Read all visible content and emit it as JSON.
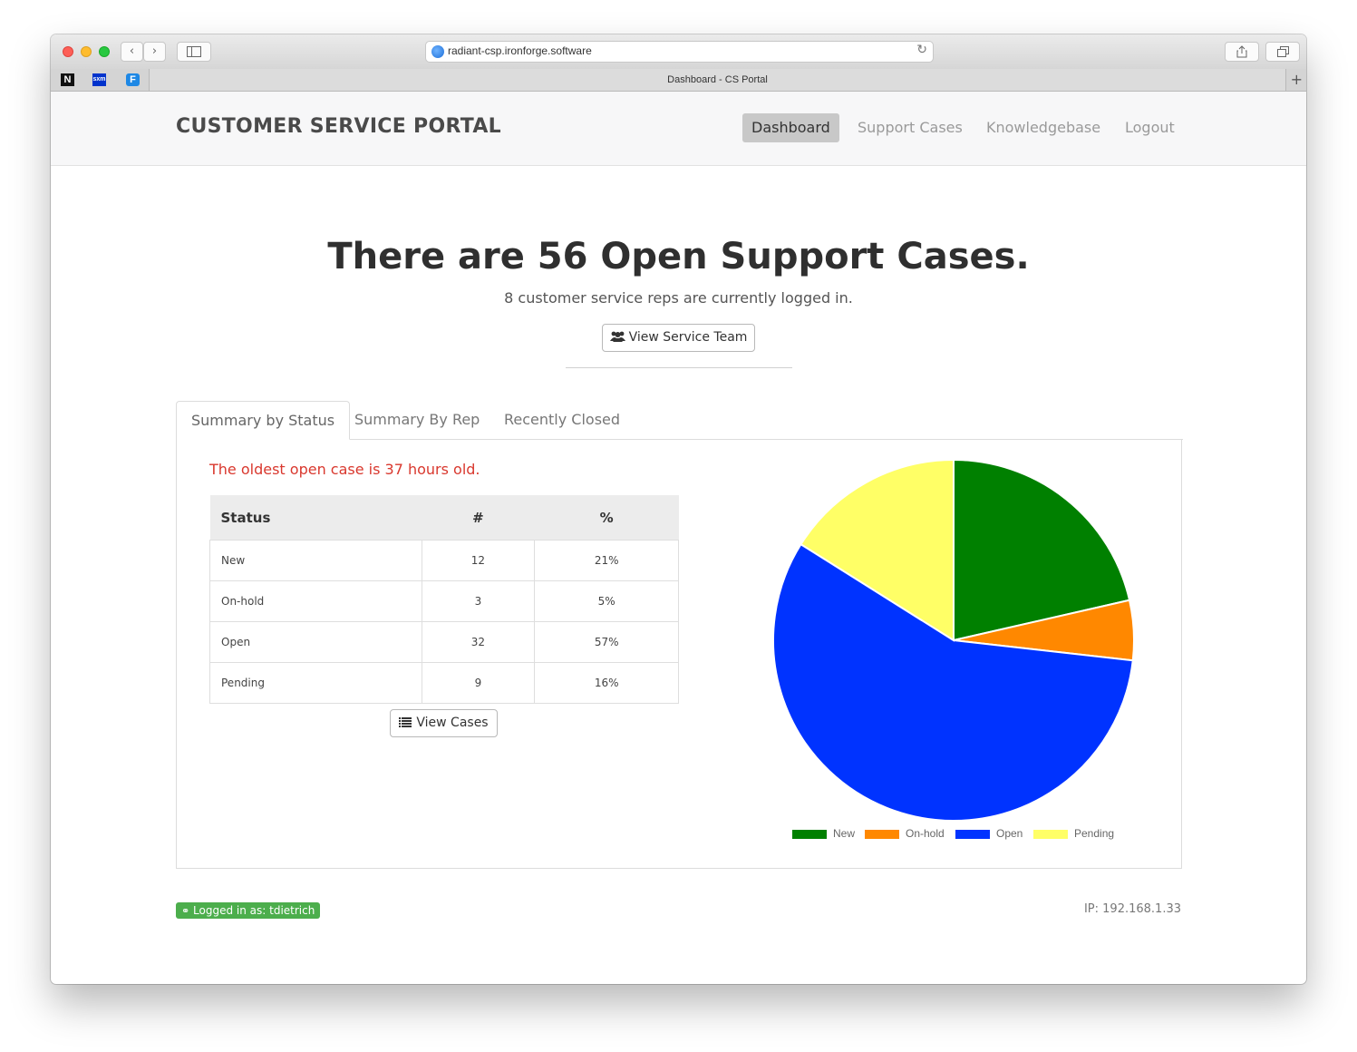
{
  "browser": {
    "url": "radiant-csp.ironforge.software",
    "tab_title": "Dashboard - CS Portal",
    "favicons": [
      "N",
      "sxm",
      "F"
    ]
  },
  "nav": {
    "brand": "CUSTOMER SERVICE PORTAL",
    "items": [
      {
        "label": "Dashboard",
        "active": true
      },
      {
        "label": "Support Cases",
        "active": false
      },
      {
        "label": "Knowledgebase",
        "active": false
      },
      {
        "label": "Logout",
        "active": false
      }
    ]
  },
  "hero": {
    "heading": "There are 56 Open Support Cases.",
    "subtext": "8 customer service reps are currently logged in.",
    "button": "View Service Team"
  },
  "tabs": [
    {
      "label": "Summary by Status",
      "active": true
    },
    {
      "label": "Summary By Rep",
      "active": false
    },
    {
      "label": "Recently Closed",
      "active": false
    }
  ],
  "summary": {
    "oldest_notice": "The oldest open case is 37 hours old.",
    "headers": [
      "Status",
      "#",
      "%"
    ],
    "rows": [
      [
        "New",
        "12",
        "21%"
      ],
      [
        "On-hold",
        "3",
        "5%"
      ],
      [
        "Open",
        "32",
        "57%"
      ],
      [
        "Pending",
        "9",
        "16%"
      ]
    ],
    "view_cases_button": "View Cases"
  },
  "chart_data": {
    "type": "pie",
    "categories": [
      "New",
      "On-hold",
      "Open",
      "Pending"
    ],
    "values": [
      12,
      3,
      32,
      9
    ],
    "colors": [
      "#008000",
      "#ff8800",
      "#0033ff",
      "#ffff66"
    ],
    "legend": "bottom"
  },
  "footer": {
    "logged_in": "Logged in as: tdietrich",
    "ip": "IP: 192.168.1.33"
  }
}
